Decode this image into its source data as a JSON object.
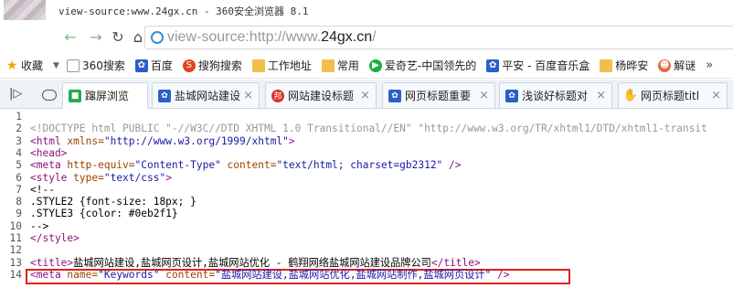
{
  "window": {
    "title": "view-source:www.24gx.cn - 360安全浏览器 8.1"
  },
  "navigation": {
    "back_icon": "arrow-left",
    "forward_icon": "arrow-right",
    "reload_icon": "reload",
    "home_icon": "home",
    "url_prefix": "view-source:http://www.",
    "url_domain": "24gx.cn",
    "url_suffix": "/"
  },
  "bookmarks": {
    "items": [
      {
        "label": "收藏",
        "icon": "star-icon"
      },
      {
        "label": "360搜索",
        "icon": "page-icon"
      },
      {
        "label": "百度",
        "icon": "paw-icon"
      },
      {
        "label": "搜狗搜索",
        "icon": "sogou-icon"
      },
      {
        "label": "工作地址",
        "icon": "folder-icon"
      },
      {
        "label": "常用",
        "icon": "folder-icon"
      },
      {
        "label": "爱奇艺-中国领先的",
        "icon": "iqiyi-icon"
      },
      {
        "label": "平安 - 百度音乐盒",
        "icon": "paw-icon"
      },
      {
        "label": "杨晔安",
        "icon": "folder-icon"
      },
      {
        "label": "解谜",
        "icon": "face-icon"
      }
    ],
    "more": "»"
  },
  "tabs": {
    "items": [
      {
        "label": "蹿屏浏览",
        "icon": "green-icon",
        "closable": false
      },
      {
        "label": "盐城网站建设",
        "icon": "paw-icon",
        "closable": true
      },
      {
        "label": "网站建设标题",
        "icon": "red-icon",
        "closable": true
      },
      {
        "label": "网页标题重要",
        "icon": "paw-icon",
        "closable": true
      },
      {
        "label": "浅谈好标题对",
        "icon": "paw-icon",
        "closable": true
      },
      {
        "label": "网页标题titl",
        "icon": "hand-icon",
        "closable": true
      }
    ],
    "close_glyph": "×"
  },
  "source": {
    "lines": [
      {
        "n": "1",
        "parts": [
          {
            "c": "",
            "t": ""
          }
        ]
      },
      {
        "n": "2",
        "parts": [
          {
            "c": "c-doctype",
            "t": "<!DOCTYPE html PUBLIC \"-//W3C//DTD XHTML 1.0 Transitional//EN\" \"http://www.w3.org/TR/xhtml1/DTD/xhtml1-transit"
          }
        ]
      },
      {
        "n": "3",
        "parts": [
          {
            "c": "c-tag",
            "t": "<html "
          },
          {
            "c": "c-attr",
            "t": "xmlns="
          },
          {
            "c": "c-val",
            "t": "\"http://www.w3.org/1999/xhtml\""
          },
          {
            "c": "c-tag",
            "t": ">"
          }
        ]
      },
      {
        "n": "4",
        "parts": [
          {
            "c": "c-tag",
            "t": "<head>"
          }
        ]
      },
      {
        "n": "5",
        "parts": [
          {
            "c": "c-tag",
            "t": "<meta "
          },
          {
            "c": "c-attr",
            "t": "http-equiv="
          },
          {
            "c": "c-val",
            "t": "\"Content-Type\""
          },
          {
            "c": "c-attr",
            "t": " content="
          },
          {
            "c": "c-val",
            "t": "\"text/html; charset=gb2312\""
          },
          {
            "c": "c-tag",
            "t": " />"
          }
        ]
      },
      {
        "n": "6",
        "parts": [
          {
            "c": "c-tag",
            "t": "<style "
          },
          {
            "c": "c-attr",
            "t": "type="
          },
          {
            "c": "c-val",
            "t": "\"text/css\""
          },
          {
            "c": "c-tag",
            "t": ">"
          }
        ]
      },
      {
        "n": "7",
        "parts": [
          {
            "c": "c-text",
            "t": "<!--"
          }
        ]
      },
      {
        "n": "8",
        "parts": [
          {
            "c": "c-text",
            "t": ".STYLE2 {font-size: 18px; }"
          }
        ]
      },
      {
        "n": "9",
        "parts": [
          {
            "c": "c-text",
            "t": ".STYLE3 {color: #0eb2f1}"
          }
        ]
      },
      {
        "n": "10",
        "parts": [
          {
            "c": "c-text",
            "t": "-->"
          }
        ]
      },
      {
        "n": "11",
        "parts": [
          {
            "c": "c-tag",
            "t": "</style>"
          }
        ]
      },
      {
        "n": "12",
        "parts": [
          {
            "c": "",
            "t": ""
          }
        ]
      },
      {
        "n": "13",
        "parts": [
          {
            "c": "c-tag",
            "t": "<title>"
          },
          {
            "c": "c-text",
            "t": "盐城网站建设,盐城网页设计,盐城网站优化 - 鹤翔网络盐城网站建设品牌公司"
          },
          {
            "c": "c-tag",
            "t": "</title>"
          }
        ]
      },
      {
        "n": "14",
        "parts": [
          {
            "c": "c-tag",
            "t": "<meta "
          },
          {
            "c": "c-attr",
            "t": "name="
          },
          {
            "c": "c-val",
            "t": "\"Keywords\""
          },
          {
            "c": "c-attr",
            "t": " content="
          },
          {
            "c": "c-val",
            "t": "\"盐城网站建设,盐城网站优化,盐城网站制作,盐城网页设计\""
          },
          {
            "c": "c-tag",
            "t": " />"
          }
        ]
      }
    ]
  },
  "colors": {
    "highlight_border": "#e0201e",
    "tag": "#881280",
    "attr": "#994500",
    "value": "#1a1aa6"
  }
}
